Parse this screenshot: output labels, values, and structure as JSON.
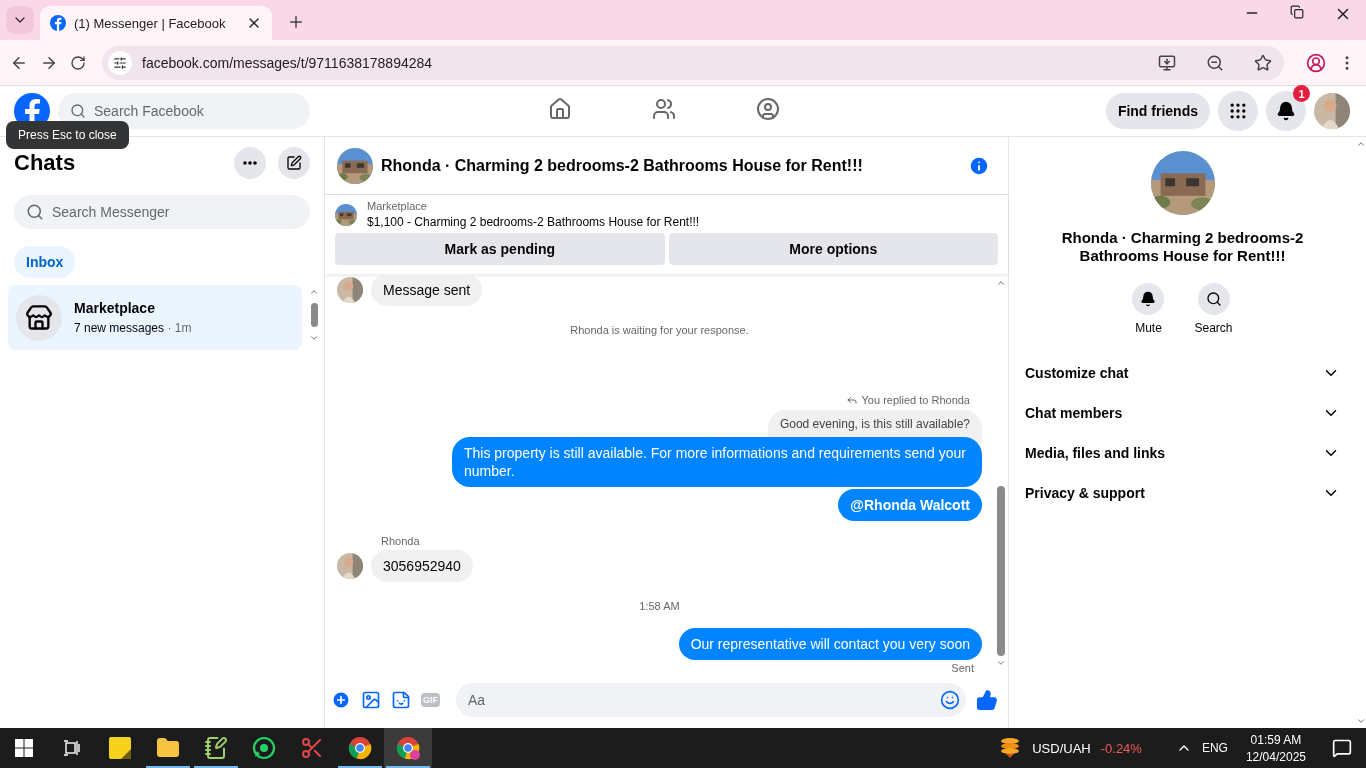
{
  "browser": {
    "tabs": [
      {
        "title": "(1) Messenger | Facebook",
        "selected": true
      }
    ],
    "url": "facebook.com/messages/t/9711638178894284"
  },
  "header": {
    "search_placeholder": "Search Facebook",
    "nav": [
      {
        "kind": "home"
      },
      {
        "kind": "friends"
      },
      {
        "kind": "groups"
      }
    ],
    "find_friends": "Find friends",
    "notifications_badge": "1"
  },
  "tooltip": "Press Esc to close",
  "chats": {
    "title": "Chats",
    "search_placeholder": "Search Messenger",
    "filters": [
      {
        "label": "Inbox",
        "selected": true
      }
    ],
    "conversations": [
      {
        "name": "Marketplace",
        "preview": "7 new messages",
        "time": "· 1m",
        "selected": true
      }
    ]
  },
  "conversation": {
    "title": "Rhonda · Charming 2 bedrooms-2 Bathrooms House for Rent!!!",
    "listing": {
      "source": "Marketplace",
      "text": "$1,100 - Charming 2 bedrooms-2 Bathrooms House for Rent!!!"
    },
    "actions": [
      "Mark as pending",
      "More options"
    ],
    "messages": [
      {
        "kind": "received",
        "text": "Message sent"
      },
      {
        "kind": "notice",
        "text": "Rhonda is waiting for your response."
      },
      {
        "kind": "reply_label",
        "text": "You replied to Rhonda"
      },
      {
        "kind": "quoted",
        "text": "Good evening, is this still available?"
      },
      {
        "kind": "sent",
        "text": "This property is still available. For more informations and requirements send your number."
      },
      {
        "kind": "mention",
        "text": "@Rhonda Walcott"
      },
      {
        "kind": "sender",
        "text": "Rhonda"
      },
      {
        "kind": "received",
        "text": "3056952940"
      },
      {
        "kind": "time",
        "text": "1:58 AM"
      },
      {
        "kind": "sent",
        "text": "Our representative will contact you very soon"
      },
      {
        "kind": "status",
        "text": "Sent"
      }
    ],
    "gif_label": "GIF",
    "composer_placeholder": "Aa"
  },
  "details": {
    "title": "Rhonda · Charming 2 bedrooms-2 Bathrooms House for Rent!!!",
    "actions": [
      {
        "kind": "mute",
        "label": "Mute"
      },
      {
        "kind": "search",
        "label": "Search"
      }
    ],
    "sections": [
      "Customize chat",
      "Chat members",
      "Media, files and links",
      "Privacy & support"
    ]
  },
  "taskbar": {
    "apps": [
      {
        "kind": "task_view",
        "running": false,
        "active": false
      },
      {
        "kind": "sticky_notes",
        "running": false,
        "active": false
      },
      {
        "kind": "file_explorer",
        "running": true,
        "active": false
      },
      {
        "kind": "notepad",
        "running": true,
        "active": false
      },
      {
        "kind": "whatsapp",
        "running": false,
        "active": false
      },
      {
        "kind": "snipping",
        "running": false,
        "active": false
      },
      {
        "kind": "chrome",
        "running": true,
        "active": false
      },
      {
        "kind": "chrome_profile",
        "running": true,
        "active": true
      }
    ],
    "ticker": "USD/UAH",
    "change": "-0.24%",
    "language": "ENG",
    "time": "01:59 AM",
    "date": "12/04/2025"
  }
}
